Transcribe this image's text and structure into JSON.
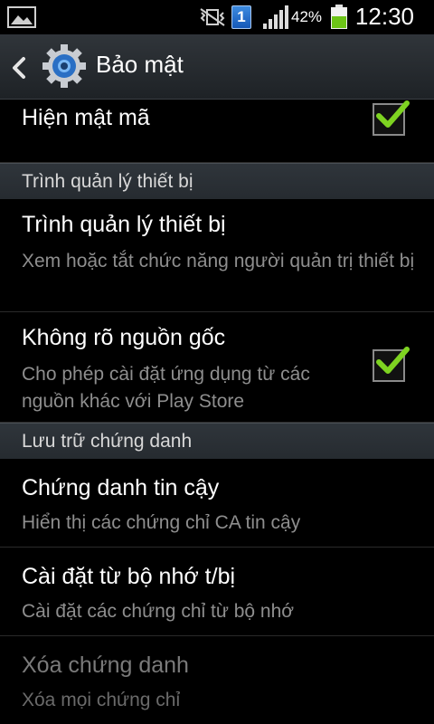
{
  "status_bar": {
    "battery_percent": "42%",
    "time": "12:30",
    "sim_slot": "1",
    "icons": [
      "gallery-icon",
      "mute-vibrate-icon",
      "sim-icon",
      "signal-icon",
      "battery-icon"
    ]
  },
  "action_bar": {
    "title": "Bảo mật",
    "icons": [
      "back-icon",
      "settings-gear-icon"
    ]
  },
  "items": [
    {
      "title": "Hiện mật mã",
      "checked": true
    },
    {
      "section": "Trình quản lý thiết bị"
    },
    {
      "title": "Trình quản lý thiết bị",
      "summary": "Xem hoặc tắt chức năng người quản trị thiết bị"
    },
    {
      "title": "Không rõ nguồn gốc",
      "summary": "Cho phép cài đặt ứng dụng từ các nguồn khác với Play Store",
      "checked": true
    },
    {
      "section": "Lưu trữ chứng danh"
    },
    {
      "title": "Chứng danh tin cậy",
      "summary": "Hiển thị các chứng chỉ CA tin cậy"
    },
    {
      "title": "Cài đặt từ bộ nhớ t/bị",
      "summary": "Cài đặt các chứng chỉ từ bộ nhớ"
    },
    {
      "title": "Xóa chứng danh",
      "summary": "Xóa mọi chứng chỉ",
      "disabled": true
    }
  ],
  "colors": {
    "accent_check": "#7ed321",
    "section_bg": "#2b3035",
    "summary_text": "#8e8e8e"
  }
}
